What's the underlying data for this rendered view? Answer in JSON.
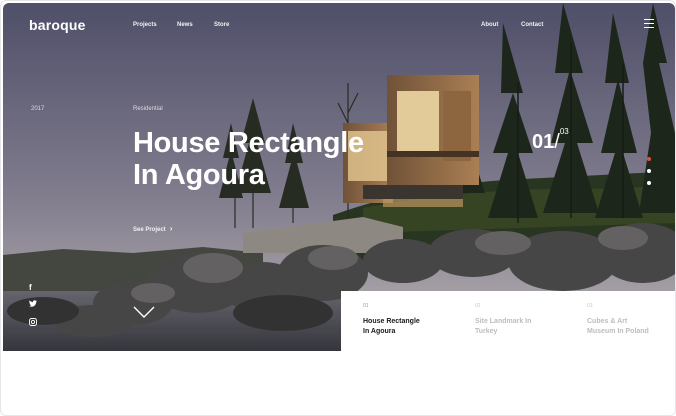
{
  "brand": {
    "logo": "baroque"
  },
  "nav": {
    "left": [
      "Projects",
      "News",
      "Store"
    ],
    "right": [
      "About",
      "Contact"
    ],
    "menu_icon": "hamburger-menu-icon"
  },
  "hero": {
    "year": "2017",
    "category": "Residential",
    "title_line1": "House Rectangle",
    "title_line2": "In Agoura",
    "cta": "See Project",
    "counter_current": "01",
    "counter_separator": "/",
    "counter_total": "03",
    "slides_total": 3,
    "slide_active_index": 0
  },
  "social": {
    "facebook": "f",
    "twitter_icon": "twitter-bird-icon",
    "instagram_icon": "instagram-icon"
  },
  "projects": [
    {
      "num": "01",
      "line1": "House Rectangle",
      "line2": "In Agoura",
      "active": true
    },
    {
      "num": "02",
      "line1": "Site Landmark In",
      "line2": "Turkey",
      "active": false
    },
    {
      "num": "03",
      "line1": "Cubes & Art",
      "line2": "Museum In Poland",
      "active": false
    }
  ],
  "colors": {
    "accent": "#e94b35",
    "sky_top": "#5a5a72",
    "sky_bottom": "#a7a2ad",
    "house_warm": "#b8875a"
  }
}
